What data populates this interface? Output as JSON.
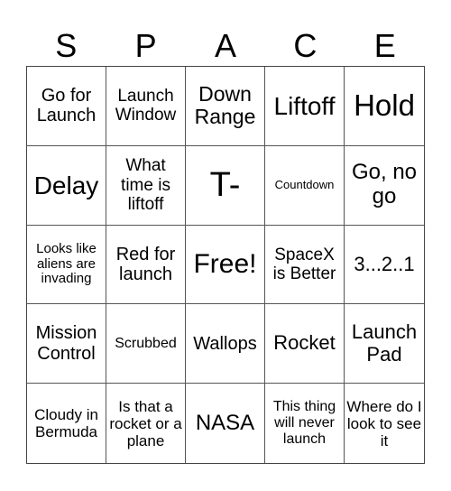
{
  "header": {
    "letters": [
      "S",
      "P",
      "A",
      "C",
      "E"
    ]
  },
  "cells": [
    {
      "text": "Go for Launch"
    },
    {
      "text": "Launch Window"
    },
    {
      "text": "Down Range"
    },
    {
      "text": "Liftoff"
    },
    {
      "text": "Hold"
    },
    {
      "text": "Delay"
    },
    {
      "text": "What time is liftoff"
    },
    {
      "text": "T-"
    },
    {
      "text": "Countdown"
    },
    {
      "text": "Go, no go"
    },
    {
      "text": "Looks like aliens are invading"
    },
    {
      "text": "Red for launch"
    },
    {
      "text": "Free!"
    },
    {
      "text": "SpaceX is Better"
    },
    {
      "text": "3...2..1"
    },
    {
      "text": "Mission Control"
    },
    {
      "text": "Scrubbed"
    },
    {
      "text": "Wallops"
    },
    {
      "text": "Rocket"
    },
    {
      "text": "Launch Pad"
    },
    {
      "text": "Cloudy in Bermuda"
    },
    {
      "text": "Is that a rocket or a plane"
    },
    {
      "text": "NASA"
    },
    {
      "text": "This thing will never launch"
    },
    {
      "text": "Where do I look to see it"
    }
  ]
}
